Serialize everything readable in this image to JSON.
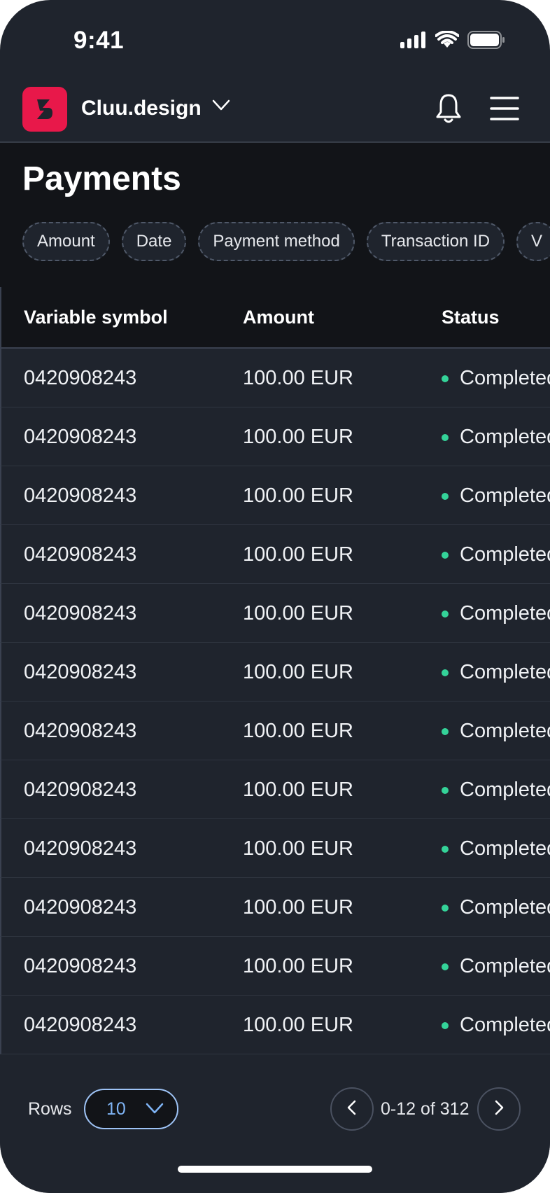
{
  "status_bar": {
    "time": "9:41"
  },
  "app_bar": {
    "brand": "Cluu.design"
  },
  "page": {
    "title": "Payments"
  },
  "filters": [
    "Amount",
    "Date",
    "Payment method",
    "Transaction ID",
    "V"
  ],
  "table": {
    "columns": [
      "Variable symbol",
      "Amount",
      "Status"
    ],
    "rows": [
      {
        "symbol": "0420908243",
        "amount": "100.00 EUR",
        "status": "Completed"
      },
      {
        "symbol": "0420908243",
        "amount": "100.00 EUR",
        "status": "Completed"
      },
      {
        "symbol": "0420908243",
        "amount": "100.00 EUR",
        "status": "Completed"
      },
      {
        "symbol": "0420908243",
        "amount": "100.00 EUR",
        "status": "Completed"
      },
      {
        "symbol": "0420908243",
        "amount": "100.00 EUR",
        "status": "Completed"
      },
      {
        "symbol": "0420908243",
        "amount": "100.00 EUR",
        "status": "Completed"
      },
      {
        "symbol": "0420908243",
        "amount": "100.00 EUR",
        "status": "Completed"
      },
      {
        "symbol": "0420908243",
        "amount": "100.00 EUR",
        "status": "Completed"
      },
      {
        "symbol": "0420908243",
        "amount": "100.00 EUR",
        "status": "Completed"
      },
      {
        "symbol": "0420908243",
        "amount": "100.00 EUR",
        "status": "Completed"
      },
      {
        "symbol": "0420908243",
        "amount": "100.00 EUR",
        "status": "Completed"
      },
      {
        "symbol": "0420908243",
        "amount": "100.00 EUR",
        "status": "Completed"
      }
    ]
  },
  "footer": {
    "rows_label": "Rows",
    "rows_value": "10",
    "page_info": "0-12 of 312"
  },
  "colors": {
    "background": "#1f242d",
    "header_band": "#121418",
    "brand_accent": "#e8184a",
    "status_completed": "#34d399",
    "select_accent": "#7fb4f5"
  },
  "icons": [
    "signal-icon",
    "wifi-icon",
    "battery-icon",
    "logo-icon",
    "chevron-down-icon",
    "bell-icon",
    "menu-icon",
    "chevron-left-icon",
    "chevron-right-icon"
  ]
}
